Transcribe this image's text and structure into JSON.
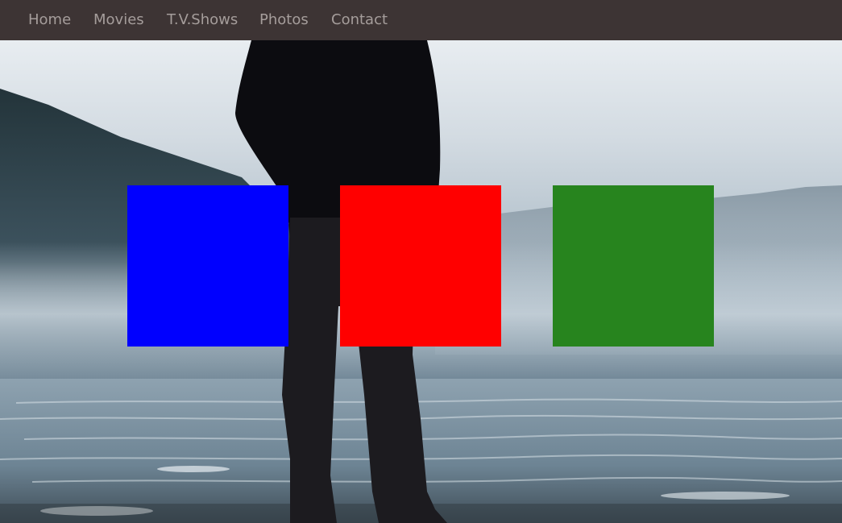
{
  "nav": {
    "items": [
      {
        "label": "Home"
      },
      {
        "label": "Movies"
      },
      {
        "label": "T.V.Shows"
      },
      {
        "label": "Photos"
      },
      {
        "label": "Contact"
      }
    ],
    "background_color": "#3d3434",
    "text_color": "#a59d9b"
  },
  "hero": {
    "background_image": "person-standing-by-misty-lake",
    "boxes": [
      {
        "color": "#0000ff"
      },
      {
        "color": "#ff0000"
      },
      {
        "color": "#27841e"
      }
    ]
  }
}
